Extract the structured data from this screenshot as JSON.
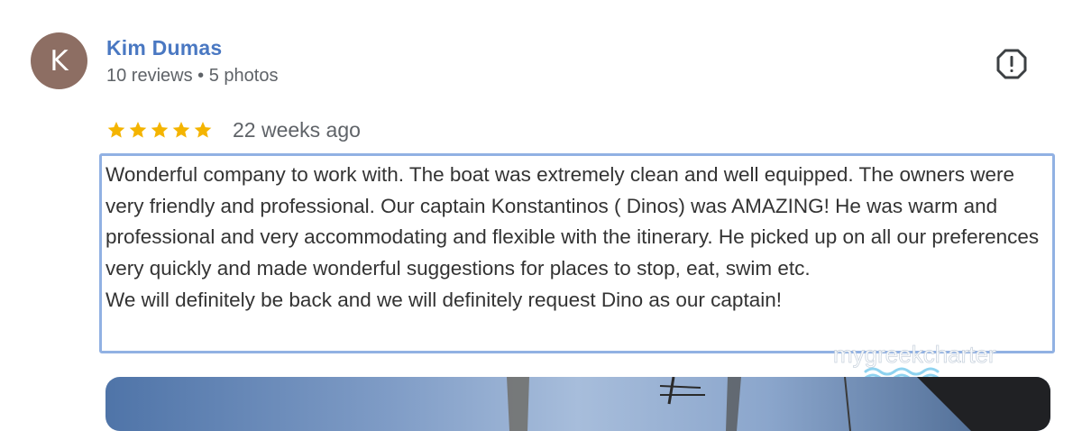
{
  "reviewer": {
    "initial": "K",
    "name": "Kim Dumas",
    "meta": "10 reviews • 5 photos",
    "avatar_color": "#8d6e63"
  },
  "review": {
    "rating": 5,
    "rating_max": 5,
    "date": "22 weeks ago",
    "text": "Wonderful company to work with. The boat was extremely clean and well equipped. The owners were very friendly and professional. Our captain Konstantinos ( Dinos) was AMAZING! He was warm and professional and very accommodating and flexible with the itinerary. He picked up on all our preferences very quickly and made wonderful suggestions for places to stop, eat, swim etc.\nWe will definitely be back and we will definitely request Dino as our captain!"
  },
  "report_icon": "report-flag-icon",
  "watermark": {
    "text": "mygreekcharter"
  },
  "colors": {
    "name": "#4a78c2",
    "star": "#f4b400",
    "highlight_border": "#91b1e3"
  }
}
